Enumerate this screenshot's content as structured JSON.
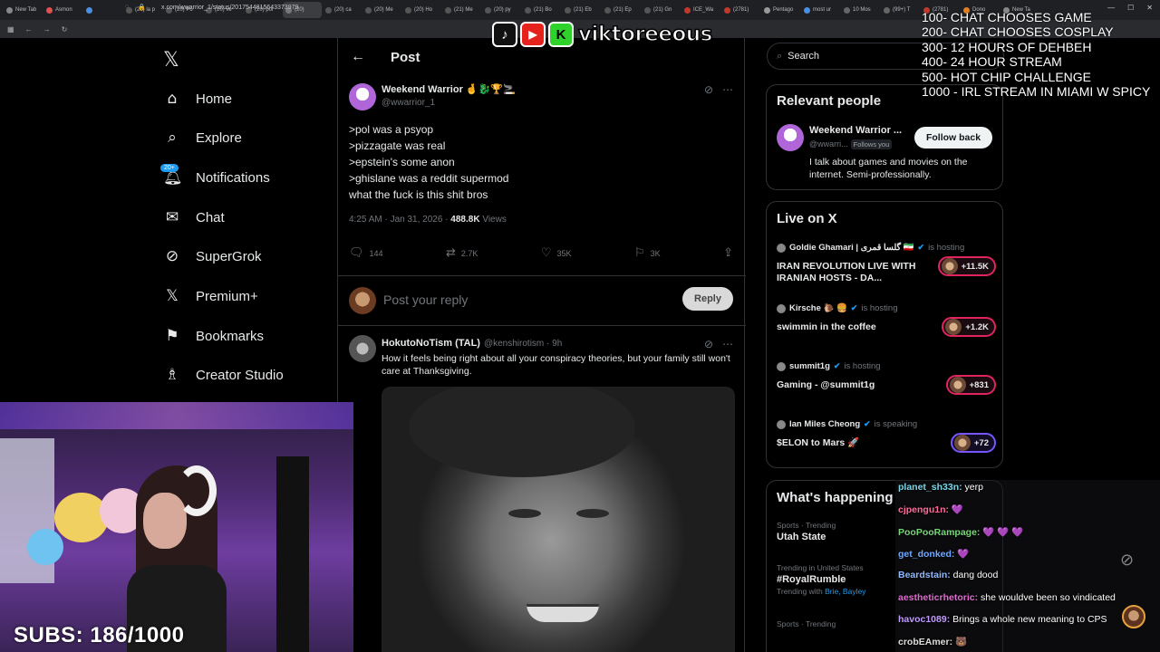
{
  "browser": {
    "tabs": [
      "New Tab",
      "Asmon",
      "",
      "(20) la p",
      "(20) Po",
      "(20) ve",
      "(20) pol",
      "(20)",
      "(20) ca",
      "(20) Me",
      "(20) Ho",
      "(21) Me",
      "(20) py",
      "(21) Bo",
      "(21) Eb",
      "(21) Ep",
      "(21) Gn",
      "ICE_Wa",
      "(2781)",
      "Pentago",
      "most ur",
      "10 Mos",
      "(99+) T",
      "(2781)",
      "Dono",
      "New Ta"
    ],
    "url": "x.com/wwarrior_1/status/2017544815643373979"
  },
  "overlay": {
    "brand": "viktoreeous",
    "goals": [
      "100- CHAT CHOOSES GAME",
      "200- CHAT CHOOSES COSPLAY",
      "300- 12 HOURS OF DEHBEH",
      "400- 24 HOUR STREAM",
      "500- HOT CHIP CHALLENGE",
      "1000 - IRL STREAM IN MIAMI W SPICY"
    ],
    "subs": "SUBS: 186/1000"
  },
  "nav": {
    "logo": "𝕏",
    "notif_badge": "20+",
    "items": [
      {
        "label": "Home",
        "icon": "home-icon"
      },
      {
        "label": "Explore",
        "icon": "search-icon"
      },
      {
        "label": "Notifications",
        "icon": "bell-icon"
      },
      {
        "label": "Chat",
        "icon": "mail-icon"
      },
      {
        "label": "SuperGrok",
        "icon": "grok-icon"
      },
      {
        "label": "Premium+",
        "icon": "x-icon"
      },
      {
        "label": "Bookmarks",
        "icon": "bookmark-icon"
      },
      {
        "label": "Creator Studio",
        "icon": "creator-icon"
      }
    ]
  },
  "post": {
    "header": "Post",
    "author_name": "Weekend Warrior 🤞🐉🏆🚬",
    "author_handle": "@wwarrior_1",
    "lines": [
      ">pol was a psyop",
      ">pizzagate was real",
      ">epstein's some anon",
      ">ghislane was a reddit supermod",
      "what the fuck is this shit bros"
    ],
    "time": "4:25 AM · Jan 31, 2026 · ",
    "views_count": "488.8K",
    "views_label": " Views",
    "replies": "144",
    "reposts": "2.7K",
    "likes": "35K",
    "bookmarks": "3K"
  },
  "reply_box": {
    "placeholder": "Post your reply",
    "button": "Reply"
  },
  "reply": {
    "name": "HokutoNoTism (TAL)",
    "handle": "@kenshirotism · 9h",
    "text": "How it feels being right about all your conspiracy theories, but your family still won't care at Thanksgiving."
  },
  "search": {
    "placeholder": "Search"
  },
  "relevant": {
    "title": "Relevant people",
    "name": "Weekend Warrior ...",
    "handle": "@wwarri...",
    "follows_you": "Follows you",
    "button": "Follow back",
    "bio": "I talk about games and movies on the internet. Semi-professionally."
  },
  "live": {
    "title": "Live on X",
    "items": [
      {
        "host": "Goldie Ghamari | گلسا قمری 🇮🇷",
        "status": "is hosting",
        "title": "IRAN REVOLUTION LIVE WITH IRANIAN HOSTS - DA...",
        "count": "+11.5K"
      },
      {
        "host": "Kirsche 🐌 🍔",
        "status": "is hosting",
        "title": "swimmin in the coffee",
        "count": "+1.2K"
      },
      {
        "host": "summit1g",
        "status": "is hosting",
        "title": "Gaming - @summit1g",
        "count": "+831"
      },
      {
        "host": "Ian Miles Cheong",
        "status": "is speaking",
        "title": "$ELON to Mars 🚀",
        "count": "+72"
      }
    ]
  },
  "happening": {
    "title": "What's happening",
    "trends": [
      {
        "cat": "Sports · Trending",
        "name": "Utah State",
        "with": ""
      },
      {
        "cat": "Trending in United States",
        "name": "#RoyalRumble",
        "with_label": "Trending with ",
        "with": "Brie, Bayley"
      },
      {
        "cat": "Sports · Trending",
        "name": "",
        "with": ""
      }
    ]
  },
  "chat": [
    {
      "user": "planet_sh33n:",
      "msg": " yerp",
      "color": "#7cd6e8"
    },
    {
      "user": "cjpengu1n:",
      "msg": " 💜",
      "color": "#ff6b9a"
    },
    {
      "user": "PooPooRampage:",
      "msg": " 💜 💜 💜",
      "color": "#7ad67a"
    },
    {
      "user": "get_donked:",
      "msg": " 💜",
      "color": "#6fa8ff"
    },
    {
      "user": "Beardstain:",
      "msg": " dang dood",
      "color": "#8fb8ff"
    },
    {
      "user": "aestheticrhetoric:",
      "msg": " she wouldve been so vindicated",
      "color": "#e06cd0"
    },
    {
      "user": "havoc1089:",
      "msg": " Brings a whole new meaning to CPS",
      "color": "#c29bff"
    },
    {
      "user": "crobEAmer:",
      "msg": " 🐻",
      "color": "#dddddd"
    }
  ]
}
